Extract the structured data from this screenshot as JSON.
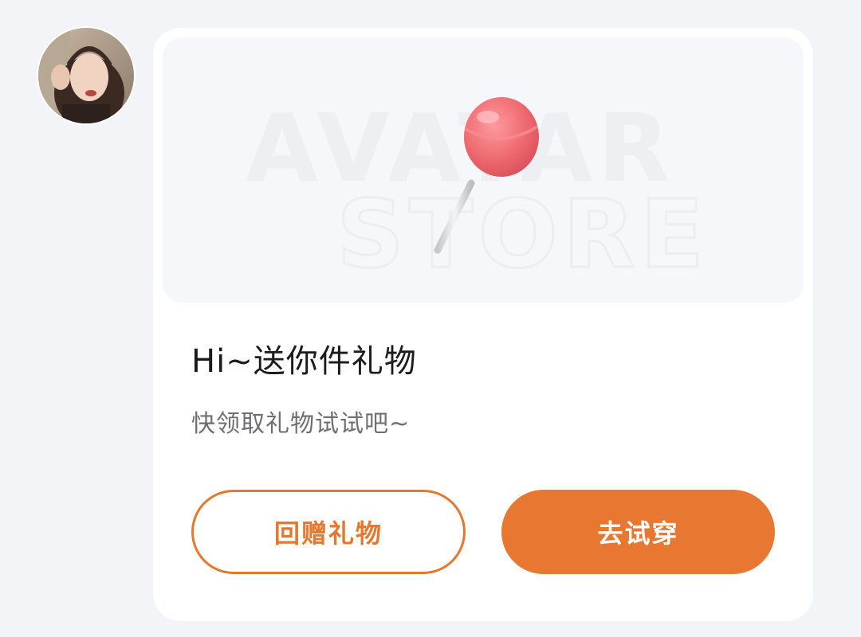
{
  "sender": {
    "avatar_icon": "user-photo-avatar"
  },
  "gift_card": {
    "banner": {
      "watermark_line1": "AVATAR",
      "watermark_line2": "STORE",
      "gift_icon": "lollipop-icon"
    },
    "title": "Hi~送你件礼物",
    "subtitle": "快领取礼物试试吧~",
    "buttons": {
      "return_gift": "回赠礼物",
      "try_on": "去试穿"
    }
  },
  "colors": {
    "accent": "#e87831",
    "title_text": "#1b1b1f",
    "subtitle_text": "#6e6e74",
    "page_background": "#f3f4f8",
    "card_background": "#ffffff",
    "lollipop_candy": "#ee6b70"
  }
}
